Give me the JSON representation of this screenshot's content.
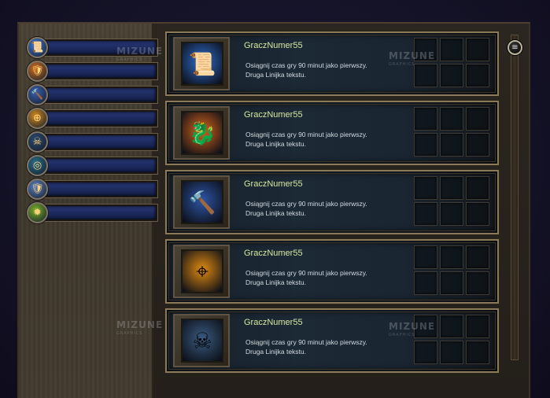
{
  "sidebar": {
    "items": [
      {
        "icon": "scroll-icon",
        "glyph": "📜",
        "color": "#3f7ad6"
      },
      {
        "icon": "shield-icon",
        "glyph": "🛡",
        "color": "#d07020"
      },
      {
        "icon": "hammer-icon",
        "glyph": "🔨",
        "color": "#3b5fb0"
      },
      {
        "icon": "crosshair-icon",
        "glyph": "⊕",
        "color": "#d08a20"
      },
      {
        "icon": "skull-icon",
        "glyph": "☠",
        "color": "#2c4a6e"
      },
      {
        "icon": "swirl-icon",
        "glyph": "◎",
        "color": "#2a6e8a"
      },
      {
        "icon": "wolf-shield-icon",
        "glyph": "🛡",
        "color": "#5d82c2"
      },
      {
        "icon": "gem-icon",
        "glyph": "✹",
        "color": "#7ab02a"
      }
    ]
  },
  "achievements": [
    {
      "title": "GraczNumer55",
      "line1": "Osiągnij czas gry 90 minut jako pierwszy.",
      "line2": "Druga Linijka tekstu.",
      "icon": "scroll-icon",
      "glyph": "📜",
      "bg": "#2f6fd0"
    },
    {
      "title": "GraczNumer55",
      "line1": "Osiągnij czas gry 90 minut jako pierwszy.",
      "line2": "Druga Linijka tekstu.",
      "icon": "dragon-shield-icon",
      "glyph": "🐉",
      "bg": "#d8641a"
    },
    {
      "title": "GraczNumer55",
      "line1": "Osiągnij czas gry 90 minut jako pierwszy.",
      "line2": "Druga Linijka tekstu.",
      "icon": "hammer-icon",
      "glyph": "🔨",
      "bg": "#2e55a6"
    },
    {
      "title": "GraczNumer55",
      "line1": "Osiągnij czas gry 90 minut jako pierwszy.",
      "line2": "Druga Linijka tekstu.",
      "icon": "crosshair-icon",
      "glyph": "⌖",
      "bg": "#e08a10"
    },
    {
      "title": "GraczNumer55",
      "line1": "Osiągnij czas gry 90 minut jako pierwszy.",
      "line2": "Druga Linijka tekstu.",
      "icon": "skull-icon",
      "glyph": "☠",
      "bg": "#3a5b80"
    }
  ],
  "scrollbar": {
    "knob_icon": "menu-icon",
    "glyph": "≡"
  },
  "watermarks": [
    {
      "text": "MIZUNE",
      "sub": "GRAPHICS"
    },
    {
      "text": "MIZUNE",
      "sub": "GRAPHICS"
    },
    {
      "text": "MIZUNE",
      "sub": "GRAPHICS"
    },
    {
      "text": "MIZUNE",
      "sub": "GRAPHICS"
    }
  ]
}
